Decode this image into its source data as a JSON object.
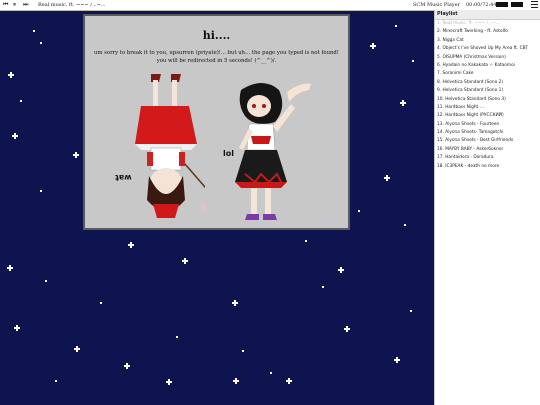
{
  "player": {
    "track": "Real music. ft. ~~~ / ..~...",
    "title": "SCM Music Player",
    "time": "00:00/72:44",
    "prev_symbol": "⏮",
    "pause_symbol": "⏸",
    "next_symbol": "⏭"
  },
  "playlist": {
    "heading": "Playlist",
    "items": [
      "1. Real music. ft. ~~~ / ..~...",
      "2. Minecraft Twerking - ft. Astolfo",
      "3. Nigga Cat",
      "4. Object's I've Shoved Up My Area ft. CBT",
      "5. OISUPMA (Christmas Version)",
      "6. Hyadain no Kakakata ☆ Kataomoi",
      "7. Soranimi Cake",
      "8. Helvetica Standard (Sono 2)",
      "9. Helvetica Standard (Sono 1)",
      "10. Helvetica Standard (Sono 3)",
      "11. Hardbass Night.....",
      "12. Hardbass Night (РУССКИЙ)",
      "13. Aiyona Shvets - Fourteen",
      "14. Aiyona Shvets- Tamagotchi",
      "15. Aiyona Shvets - Best Girlfriends",
      "16. MAYBY BABY - Asker6oknor",
      "17. Hantaidora - Doradura",
      "18. IC3PEAK - death no more"
    ]
  },
  "error_box": {
    "heading": "hi....",
    "message": "um sorry to break it to you, upsurren (priyate)!... but uh... the page you typed is not found! you will be redirected in 5 seconds! (^__^)/.",
    "lol": "lol",
    "wat": "wat"
  },
  "colors": {
    "background": "#0d1450",
    "box": "#c8c8c8",
    "playlist_active": "#b6b6b6"
  }
}
